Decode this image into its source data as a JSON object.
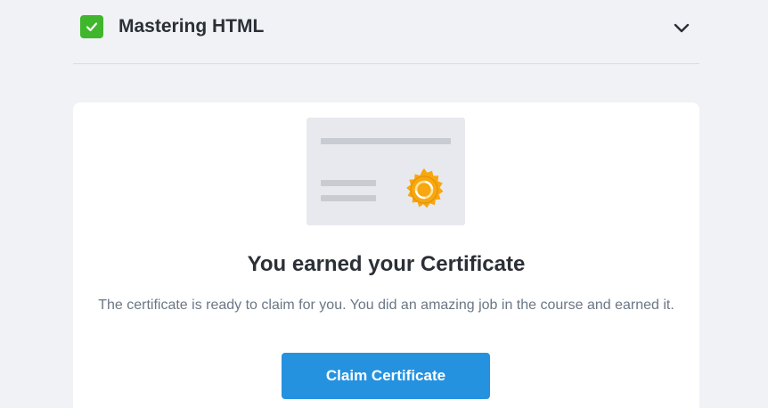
{
  "course": {
    "title": "Mastering HTML",
    "completed": true,
    "status_icon": "check-icon",
    "toggle_icon": "chevron-down-icon"
  },
  "certificate": {
    "title": "You earned your Certificate",
    "description": "The certificate is ready to claim for you. You did an amazing job in the course and earned it.",
    "button_label": "Claim Certificate",
    "illustration_icon": "certificate-icon",
    "seal_icon": "seal-icon"
  },
  "colors": {
    "background": "#f0f2f5",
    "check_green": "#3fb62b",
    "button_blue": "#2592e0",
    "seal_orange": "#f7a70f"
  }
}
